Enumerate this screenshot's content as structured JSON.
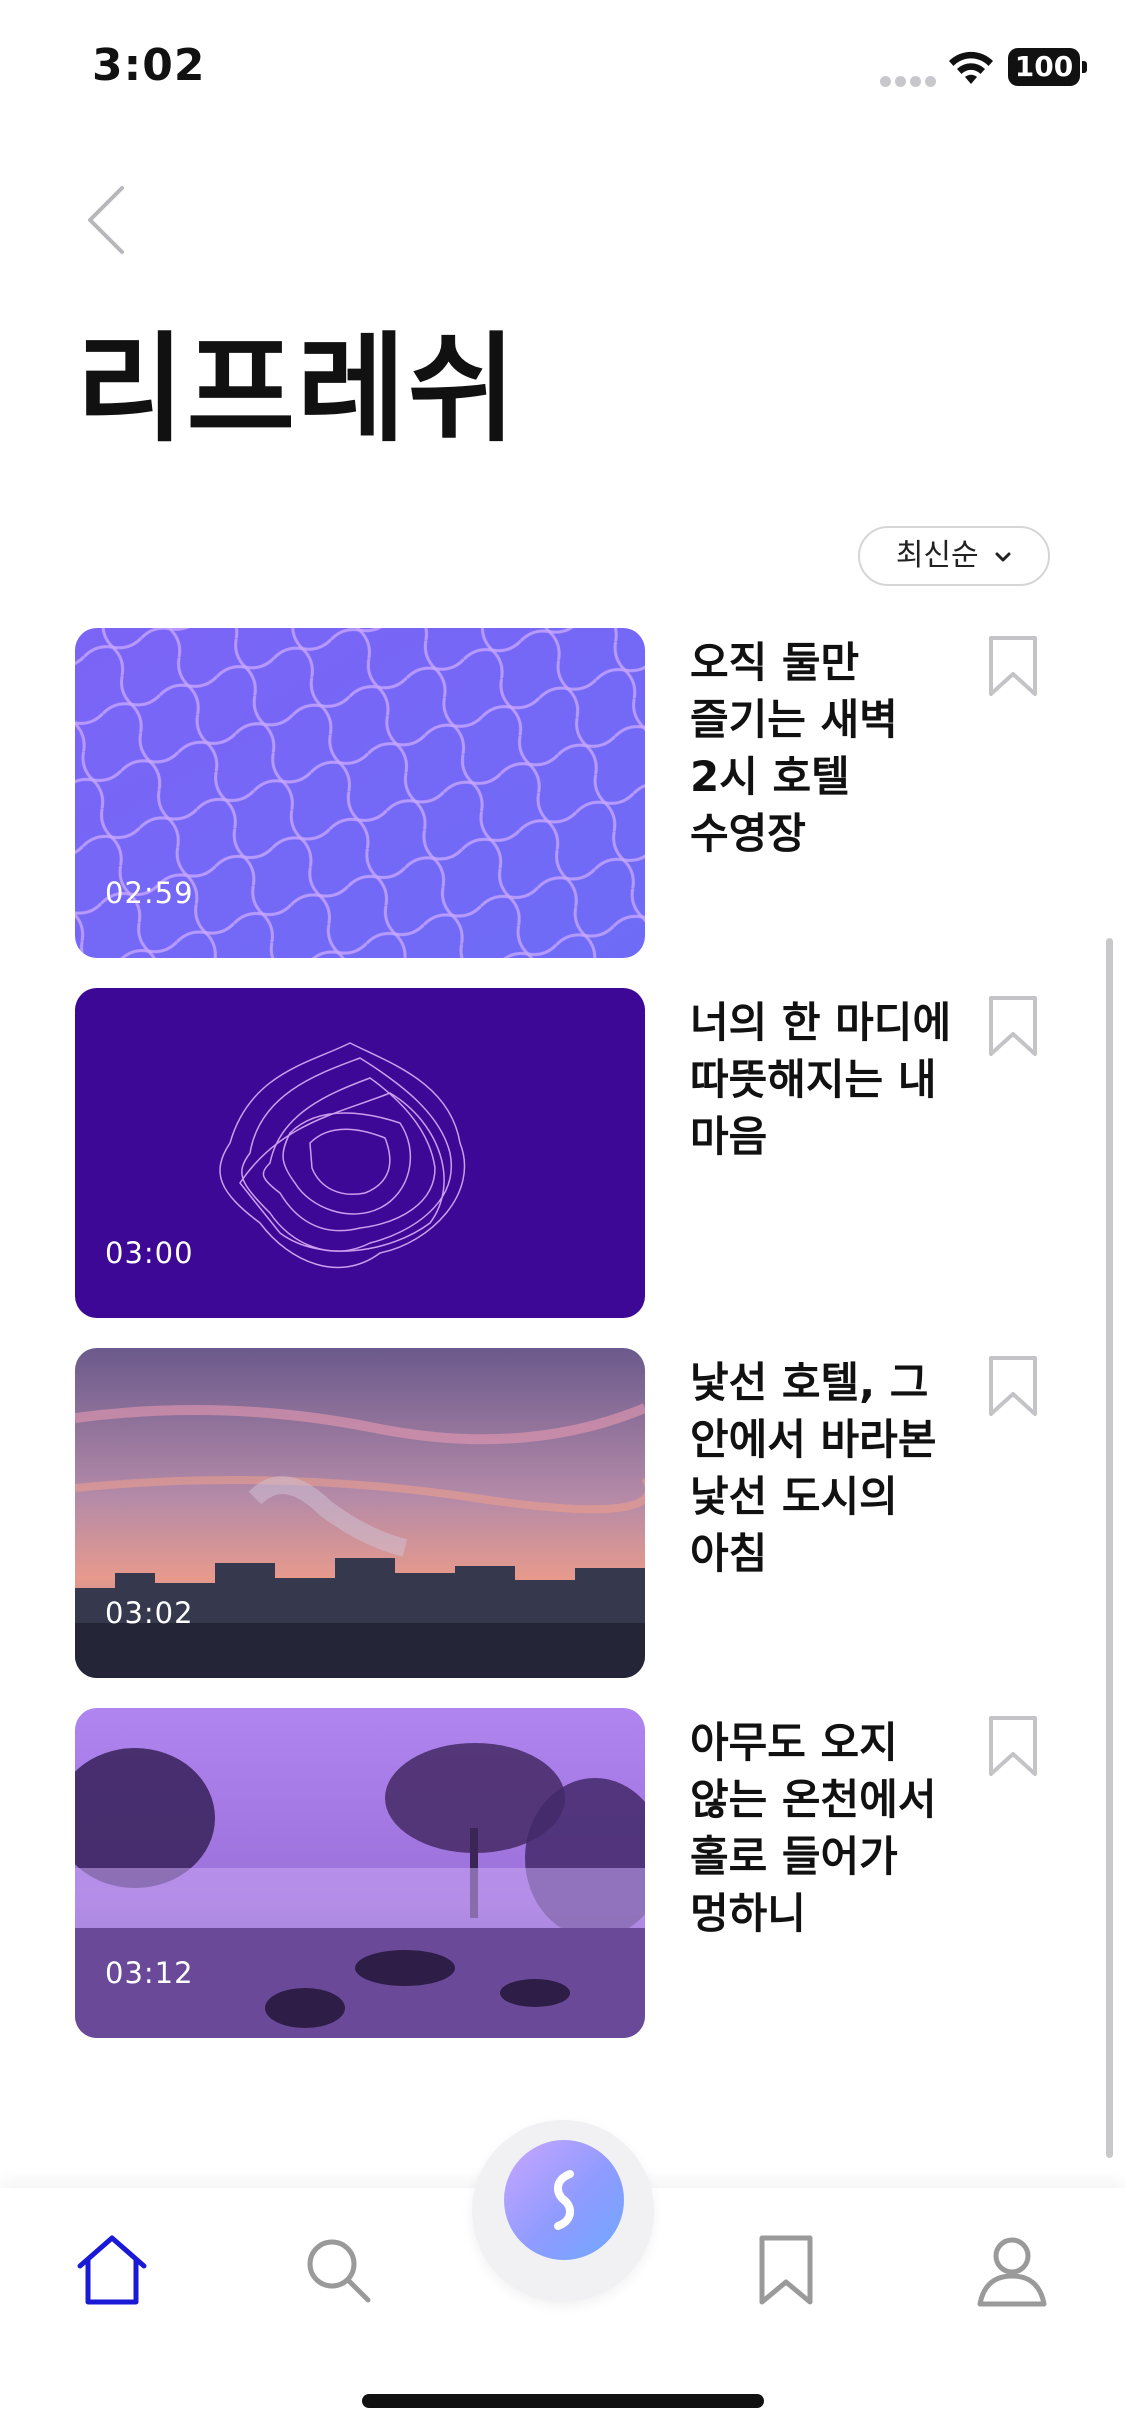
{
  "status": {
    "time": "3:02",
    "battery": "100"
  },
  "header": {
    "title": "리프레쉬"
  },
  "sort": {
    "selected": "최신순"
  },
  "items": [
    {
      "duration": "02:59",
      "title": "오직 둘만 즐기는 새벽 2시 호텔 수영장"
    },
    {
      "duration": "03:00",
      "title": "너의 한 마디에 따뜻해지는 내 마음"
    },
    {
      "duration": "03:02",
      "title": "낯선 호텔, 그 안에서 바라본 낯선 도시의 아침"
    },
    {
      "duration": "03:12",
      "title": "아무도 오지 않는 온천에서 홀로 들어가 멍하니"
    }
  ],
  "tabbar": {
    "items": [
      "home-icon",
      "search-icon",
      "center-logo-icon",
      "bookmark-icon",
      "profile-icon"
    ],
    "active_color": "#1a1ad6",
    "inactive_color": "#9a9a9a"
  }
}
